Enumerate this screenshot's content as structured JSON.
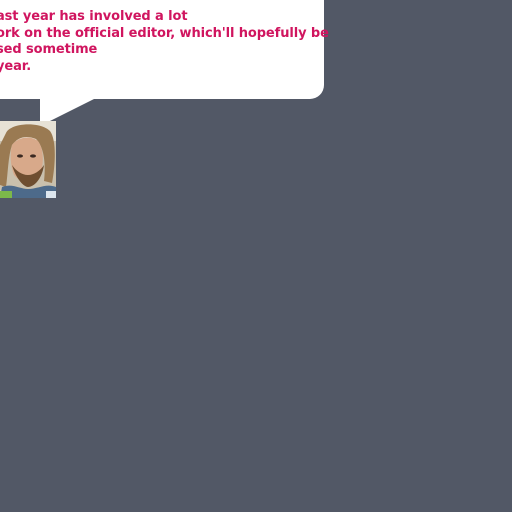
{
  "speech_bubble": {
    "lines": [
      "ast year has involved a lot",
      "ork on the official editor, which'll hopefully be",
      "sed sometime",
      "year."
    ]
  },
  "avatar": {
    "icon": "person-photo"
  },
  "colors": {
    "background": "#525866",
    "bubble": "#ffffff",
    "text": "#d0155f"
  }
}
